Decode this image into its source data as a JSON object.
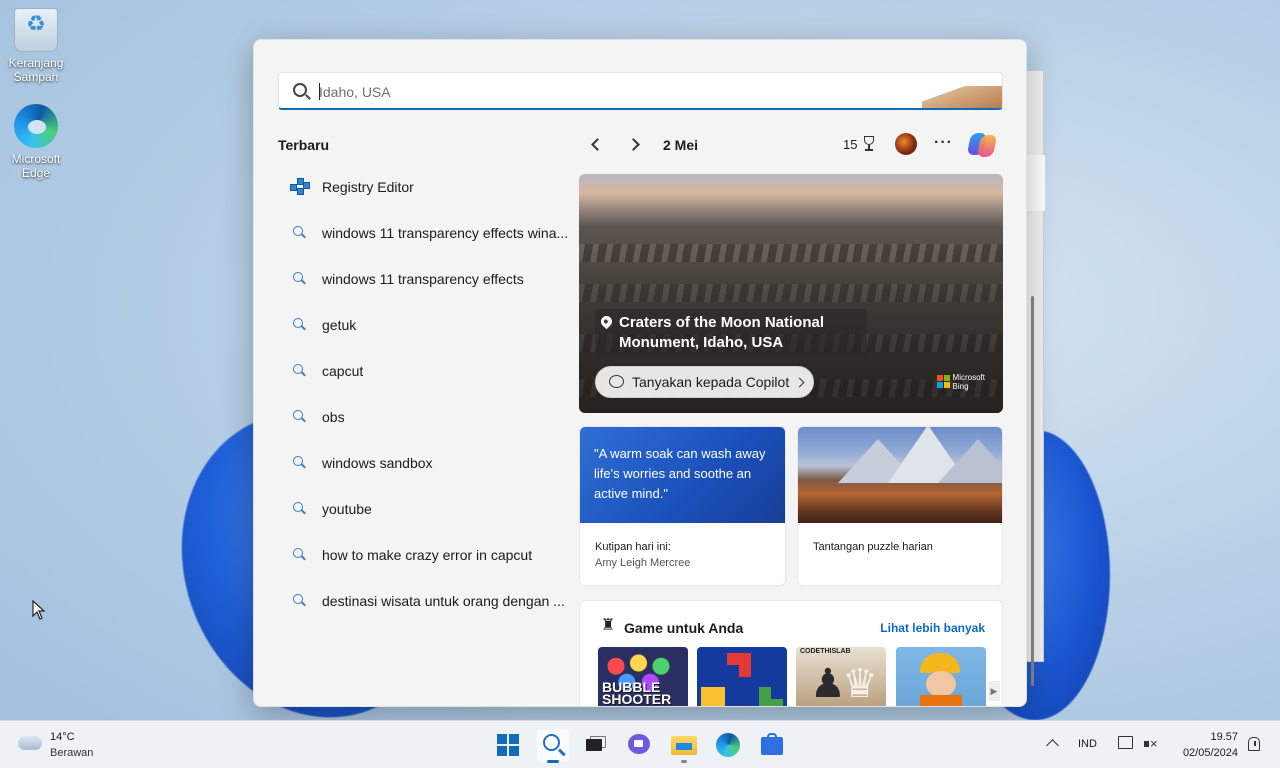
{
  "desktop": {
    "icons": [
      {
        "label": "Keranjang Sampah",
        "icon": "recycle-bin-icon"
      },
      {
        "label": "Microsoft Edge",
        "icon": "edge-icon"
      }
    ]
  },
  "search": {
    "placeholder": "Idaho, USA",
    "value": ""
  },
  "recent": {
    "title": "Terbaru",
    "items": [
      {
        "label": "Registry Editor",
        "icon": "registry-editor-icon"
      },
      {
        "label": "windows 11 transparency effects wina...",
        "icon": "search-icon"
      },
      {
        "label": "windows 11 transparency effects",
        "icon": "search-icon"
      },
      {
        "label": "getuk",
        "icon": "search-icon"
      },
      {
        "label": "capcut",
        "icon": "search-icon"
      },
      {
        "label": "obs",
        "icon": "search-icon"
      },
      {
        "label": "windows sandbox",
        "icon": "search-icon"
      },
      {
        "label": "youtube",
        "icon": "search-icon"
      },
      {
        "label": "how to make crazy error in capcut",
        "icon": "search-icon"
      },
      {
        "label": "destinasi wisata untuk orang dengan ...",
        "icon": "search-icon"
      }
    ]
  },
  "highlights": {
    "date": "2 Mei",
    "points": "15",
    "more_glyph": "···"
  },
  "hero": {
    "location_line1": "Craters of the Moon National",
    "location_line2": "Monument, Idaho, USA",
    "ask_copilot": "Tanyakan kepada Copilot",
    "brand_line1": "Microsoft",
    "brand_line2": "Bing"
  },
  "quote_card": {
    "quote": "\"A warm soak can wash away life's worries and soothe an active mind.\"",
    "label": "Kutipan hari ini:",
    "author": "Amy Leigh Mercree"
  },
  "puzzle_card": {
    "label": "Tantangan puzzle harian"
  },
  "games": {
    "title": "Game untuk Anda",
    "more_link": "Lihat lebih banyak",
    "tiles": [
      {
        "label": "BUBBLE SHOOTER"
      },
      {
        "label": ""
      },
      {
        "label": "CODETHISLAB"
      },
      {
        "label": ""
      }
    ]
  },
  "taskbar": {
    "temperature": "14°C",
    "condition": "Berawan",
    "language": "IND",
    "time": "19.57",
    "date": "02/05/2024"
  },
  "colors": {
    "accent": "#0f6cbd",
    "panel_bg": "#f4f4f4",
    "quote_bg": "#1a4fb9"
  }
}
